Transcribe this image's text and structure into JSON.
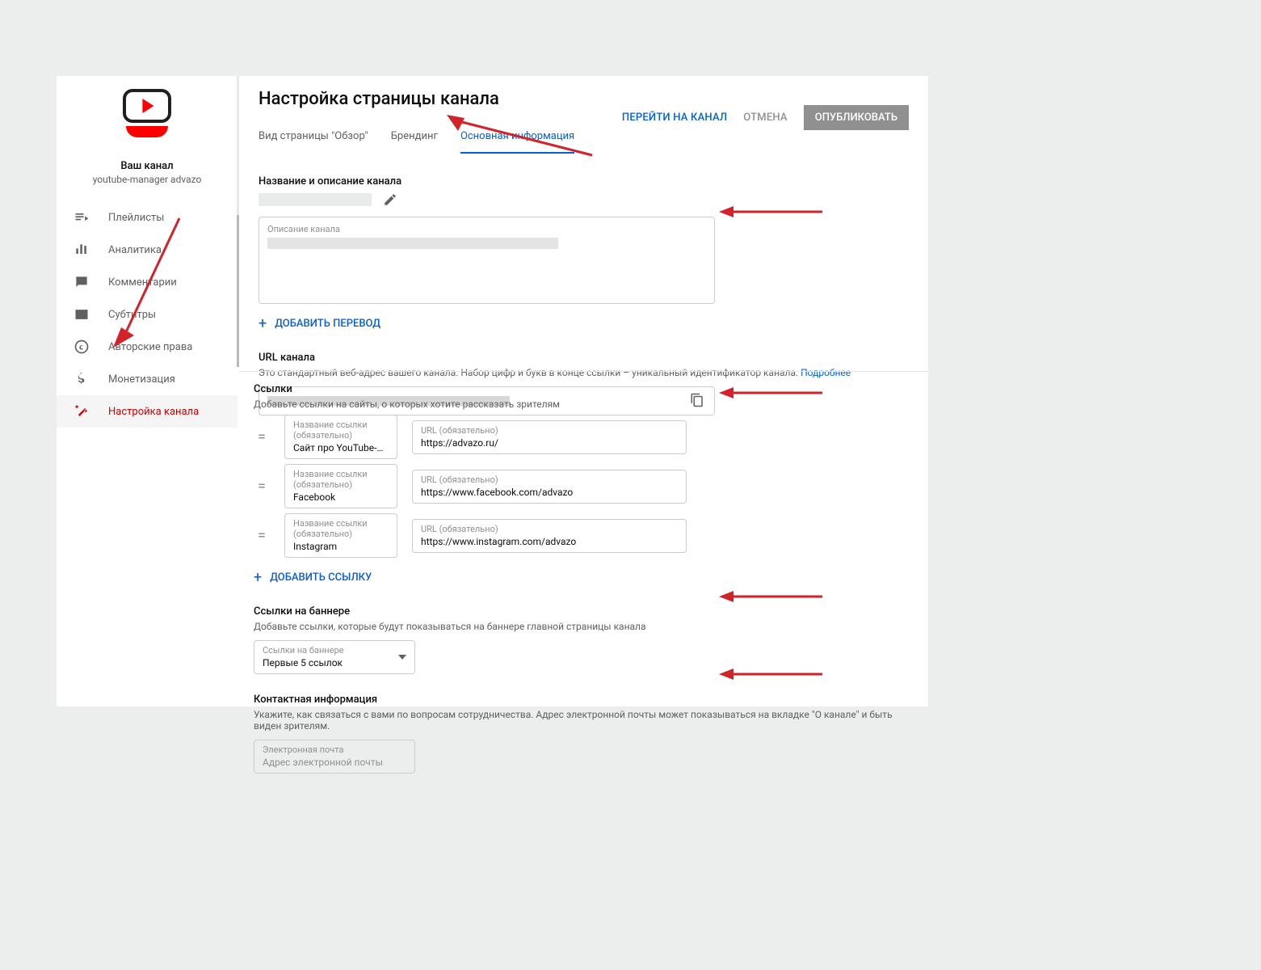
{
  "sidebar": {
    "channel_label": "Ваш канал",
    "channel_sub": "youtube-manager advazo",
    "items": [
      {
        "label": "Плейлисты"
      },
      {
        "label": "Аналитика"
      },
      {
        "label": "Комментарии"
      },
      {
        "label": "Субтитры"
      },
      {
        "label": "Авторские права"
      },
      {
        "label": "Монетизация"
      },
      {
        "label": "Настройка канала"
      }
    ]
  },
  "header": {
    "title": "Настройка страницы канала",
    "view_channel": "ПЕРЕЙТИ НА КАНАЛ",
    "cancel": "ОТМЕНА",
    "publish": "ОПУБЛИКОВАТЬ"
  },
  "tabs": [
    "Вид страницы \"Обзор\"",
    "Брендинг",
    "Основная информация"
  ],
  "active_tab": 2,
  "name_section": {
    "title": "Название и описание канала",
    "desc_label": "Описание канала",
    "add_translation": "ДОБАВИТЬ ПЕРЕВОД"
  },
  "url_section": {
    "title": "URL канала",
    "desc": "Это стандартный веб-адрес вашего канала. Набор цифр и букв в конце ссылки – уникальный идентификатор канала.",
    "learn_more": "Подробнее"
  },
  "links": {
    "title": "Ссылки",
    "desc": "Добавьте ссылки на сайты, о которых хотите рассказать зрителям",
    "name_label": "Название ссылки (обязательно)",
    "url_label": "URL (обязательно)",
    "rows": [
      {
        "name": "Сайт про YouTube-продви...",
        "url": "https://advazo.ru/"
      },
      {
        "name": "Facebook",
        "url": "https://www.facebook.com/advazo"
      },
      {
        "name": "Instagram",
        "url": "https://www.instagram.com/advazo"
      }
    ],
    "add_link": "ДОБАВИТЬ ССЫЛКУ"
  },
  "banner": {
    "title": "Ссылки на баннере",
    "desc": "Добавьте ссылки, которые будут показываться на баннере главной страницы канала",
    "field_label": "Ссылки на баннере",
    "value": "Первые 5 ссылок"
  },
  "contact": {
    "title": "Контактная информация",
    "desc": "Укажите, как связаться с вами по вопросам сотрудничества. Адрес электронной почты может показываться на вкладке \"О канале\" и быть виден зрителям.",
    "field_label": "Электронная почта",
    "placeholder": "Адрес электронной почты"
  }
}
